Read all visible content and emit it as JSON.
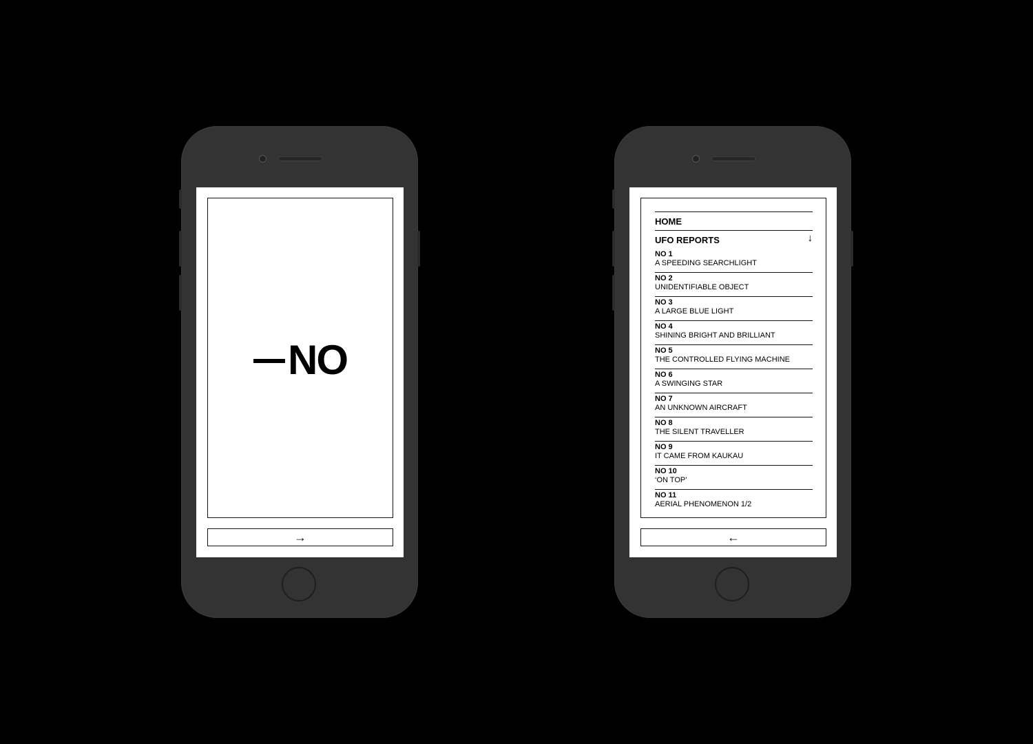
{
  "left_phone": {
    "logo_text": "NO",
    "arrow": "→"
  },
  "right_phone": {
    "menu": {
      "home": "HOME",
      "section": "UFO REPORTS",
      "section_arrow": "↓"
    },
    "reports": [
      {
        "no": "NO 1",
        "title": "A SPEEDING SEARCHLIGHT"
      },
      {
        "no": "NO 2",
        "title": "UNIDENTIFIABLE OBJECT"
      },
      {
        "no": "NO 3",
        "title": "A LARGE BLUE LIGHT"
      },
      {
        "no": "NO 4",
        "title": "SHINING BRIGHT AND BRILLIANT"
      },
      {
        "no": "NO 5",
        "title": "THE CONTROLLED FLYING MACHINE"
      },
      {
        "no": "NO 6",
        "title": "A SWINGING STAR"
      },
      {
        "no": "NO 7",
        "title": "AN UNKNOWN AIRCRAFT"
      },
      {
        "no": "NO 8",
        "title": "THE SILENT TRAVELLER"
      },
      {
        "no": "NO 9",
        "title": "IT CAME FROM KAUKAU"
      },
      {
        "no": "NO 10",
        "title": "‘ON TOP’"
      },
      {
        "no": "NO 11",
        "title": "AERIAL PHENOMENON 1/2"
      }
    ],
    "arrow": "←"
  }
}
